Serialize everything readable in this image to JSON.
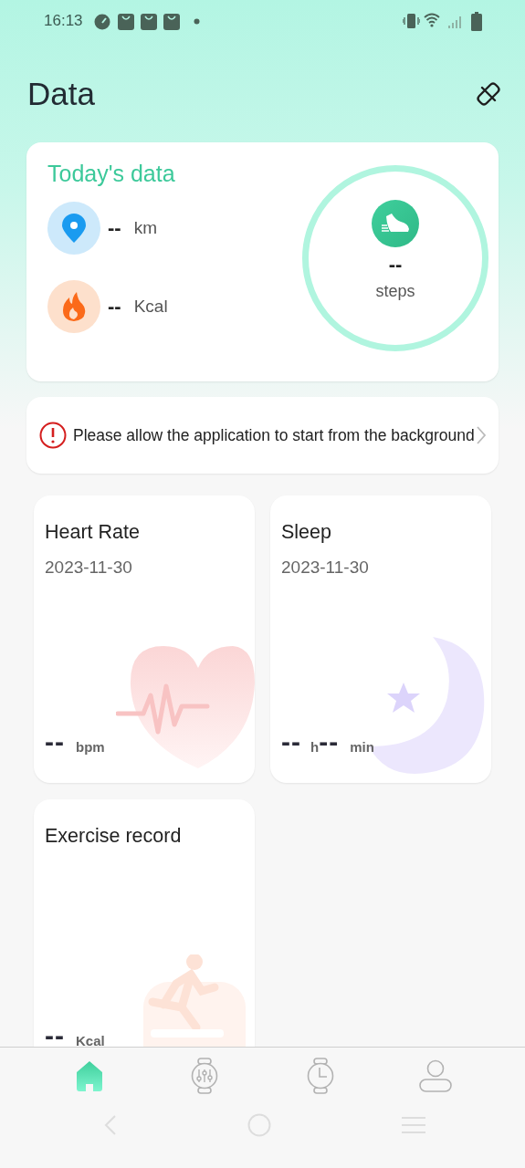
{
  "status_bar": {
    "time": "16:13"
  },
  "header": {
    "title": "Data"
  },
  "today": {
    "title": "Today's data",
    "distance": {
      "value": "--",
      "unit": "km"
    },
    "calories": {
      "value": "--",
      "unit": "Kcal"
    },
    "steps": {
      "value": "--",
      "unit": "steps"
    }
  },
  "alert": {
    "text": "Please allow the application to start from the background"
  },
  "cards": [
    {
      "kind": "heart",
      "title": "Heart Rate",
      "date": "2023-11-30",
      "values": [
        {
          "value": "--",
          "unit": "bpm"
        }
      ]
    },
    {
      "kind": "sleep",
      "title": "Sleep",
      "date": "2023-11-30",
      "values": [
        {
          "value": "--",
          "unit": "h"
        },
        {
          "value": "--",
          "unit": "min"
        }
      ]
    },
    {
      "kind": "exercise",
      "title": "Exercise record",
      "values": [
        {
          "value": "--",
          "unit": "Kcal"
        }
      ]
    }
  ],
  "tabs": [
    {
      "kind": "home",
      "selected": true
    },
    {
      "kind": "watch-settings",
      "selected": false
    },
    {
      "kind": "watch",
      "selected": false
    },
    {
      "kind": "profile",
      "selected": false
    }
  ]
}
